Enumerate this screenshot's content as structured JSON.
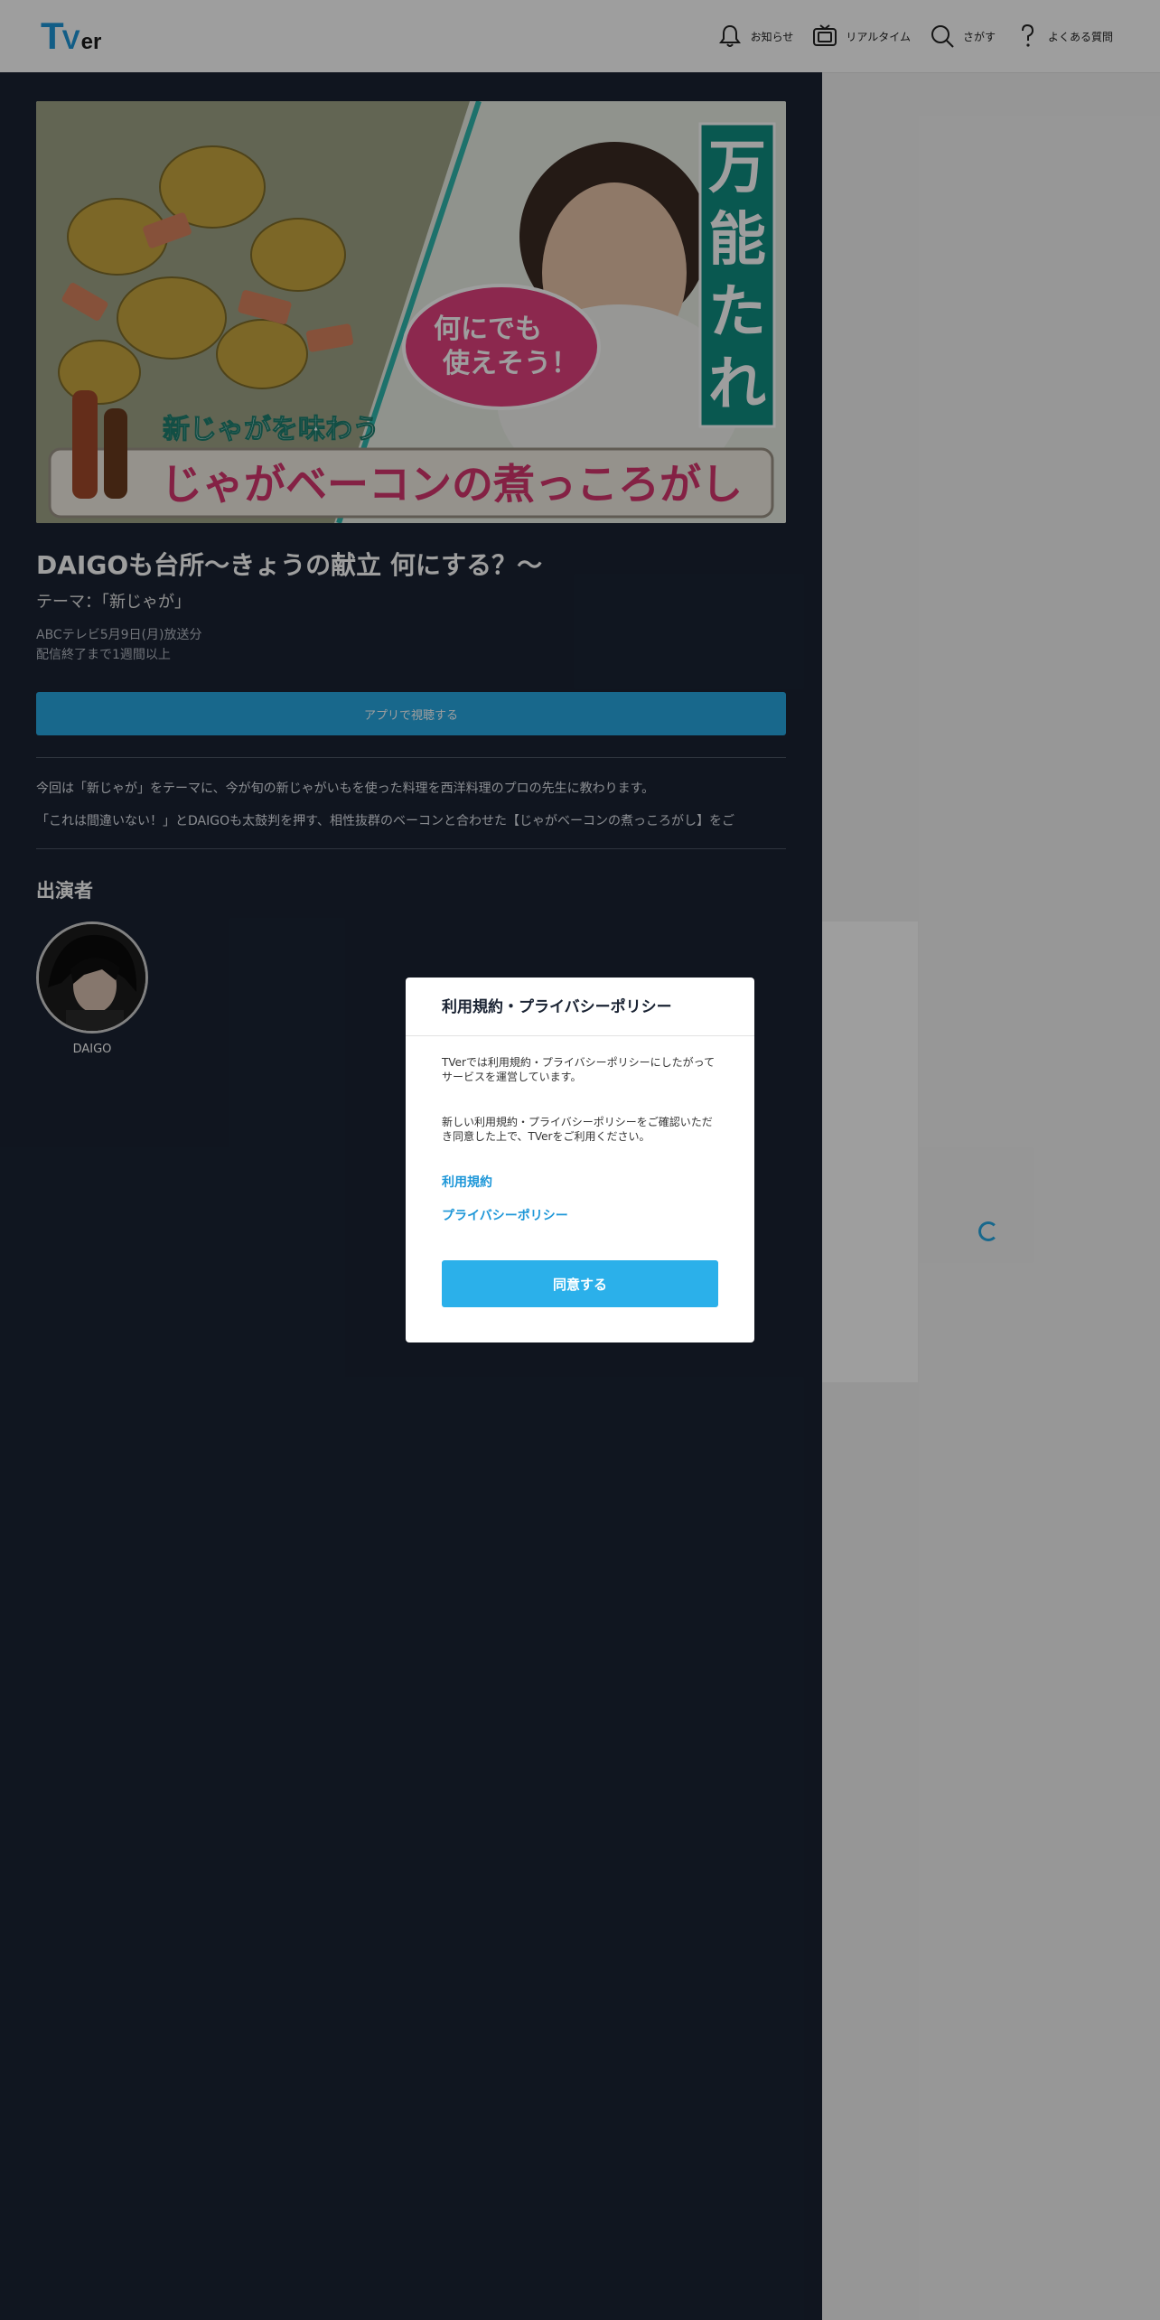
{
  "header": {
    "logo": "TVer",
    "nav": [
      {
        "label": "お知らせ",
        "icon": "bell-icon"
      },
      {
        "label": "リアルタイム",
        "icon": "tv-icon"
      },
      {
        "label": "さがす",
        "icon": "search-icon"
      },
      {
        "label": "よくある質問",
        "icon": "question-icon"
      }
    ]
  },
  "episode": {
    "thumbnail_text": {
      "vertical": [
        "万",
        "能",
        "た",
        "れ"
      ],
      "bubble": [
        "何にでも",
        "使えそう！"
      ],
      "banner_small": "新じゃがを味わう",
      "banner_large": "じゃがベーコンの煮っころがし"
    },
    "title": "DAIGOも台所～きょうの献立 何にする？～",
    "subtitle": "テーマ：「新じゃが」",
    "broadcast": "ABCテレビ5月9日(月)放送分",
    "availability": "配信終了まで1週間以上",
    "watch_button": "アプリで視聴する",
    "description": [
      "今回は「新じゃが」をテーマに、今が旬の新じゃがいもを使った料理を西洋料理のプロの先生に教わります。",
      "「これは間違いない！」とDAIGOも太鼓判を押す、相性抜群のベーコンと合わせた【じゃがベーコンの煮っころがし】をご"
    ]
  },
  "cast": {
    "heading": "出演者",
    "members": [
      {
        "name": "DAIGO"
      }
    ]
  },
  "modal": {
    "title": "利用規約・プライバシーポリシー",
    "paragraph1": "TVerでは利用規約・プライバシーポリシーにしたがってサービスを運営しています。",
    "paragraph2": "新しい利用規約・プライバシーポリシーをご確認いただき同意した上で、TVerをご利用ください。",
    "link_terms": "利用規約",
    "link_privacy": "プライバシーポリシー",
    "agree_button": "同意する"
  },
  "colors": {
    "accent": "#27a8e3",
    "main_bg": "#1a2333",
    "header_bg": "#ffffff"
  }
}
